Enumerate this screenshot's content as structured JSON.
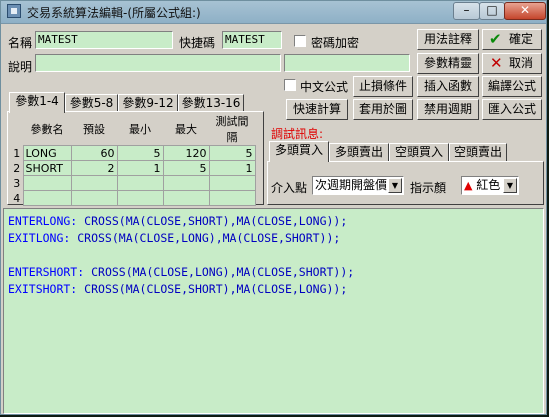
{
  "window": {
    "title": "交易系統算法編輯-(所屬公式組:)"
  },
  "form": {
    "name_label": "名稱",
    "name_value": "MATEST",
    "shortcut_label": "快捷碼",
    "shortcut_value": "MATEST",
    "password_label": "密碼加密",
    "desc_label": "說明",
    "desc_value": "",
    "chinese_formula_label": "中文公式"
  },
  "buttons": {
    "usage_notes": "用法註釋",
    "confirm": "確定",
    "param_wizard": "參數精靈",
    "cancel": "取消",
    "stop_loss": "止損條件",
    "insert_function": "插入函數",
    "compile": "編譯公式",
    "quick_calc": "快速計算",
    "apply_to_chart": "套用於圖",
    "disable_period": "禁用週期",
    "import_formula": "匯入公式"
  },
  "param_tabs": [
    "參數1-4",
    "參數5-8",
    "參數9-12",
    "參數13-16"
  ],
  "params": {
    "headers": [
      "參數名",
      "預設",
      "最小",
      "最大",
      "測試間隔"
    ],
    "rows": [
      {
        "no": "1",
        "name": "LONG",
        "default": "60",
        "min": "5",
        "max": "120",
        "step": "5"
      },
      {
        "no": "2",
        "name": "SHORT",
        "default": "2",
        "min": "1",
        "max": "5",
        "step": "1"
      },
      {
        "no": "3",
        "name": "",
        "default": "",
        "min": "",
        "max": "",
        "step": ""
      },
      {
        "no": "4",
        "name": "",
        "default": "",
        "min": "",
        "max": "",
        "step": ""
      }
    ]
  },
  "debug": {
    "label": "調試訊息:"
  },
  "trade_tabs": [
    "多頭買入",
    "多頭賣出",
    "空頭買入",
    "空頭賣出"
  ],
  "entry": {
    "label": "介入點",
    "value": "次週期開盤價",
    "indicator_label": "指示顏",
    "indicator_value": "紅色"
  },
  "code_lines": [
    {
      "key": "ENTERLONG:",
      "body": " CROSS(MA(CLOSE,SHORT),MA(CLOSE,LONG));"
    },
    {
      "key": "EXITLONG:",
      "body": " CROSS(MA(CLOSE,LONG),MA(CLOSE,SHORT));"
    },
    {
      "key": "",
      "body": ""
    },
    {
      "key": "ENTERSHORT:",
      "body": " CROSS(MA(CLOSE,LONG),MA(CLOSE,SHORT));"
    },
    {
      "key": "EXITSHORT:",
      "body": " CROSS(MA(CLOSE,SHORT),MA(CLOSE,LONG));"
    }
  ],
  "colors": {
    "code_bg": "#c8ecc8",
    "keyword": "#0000ff",
    "debug_red": "#e00000"
  }
}
